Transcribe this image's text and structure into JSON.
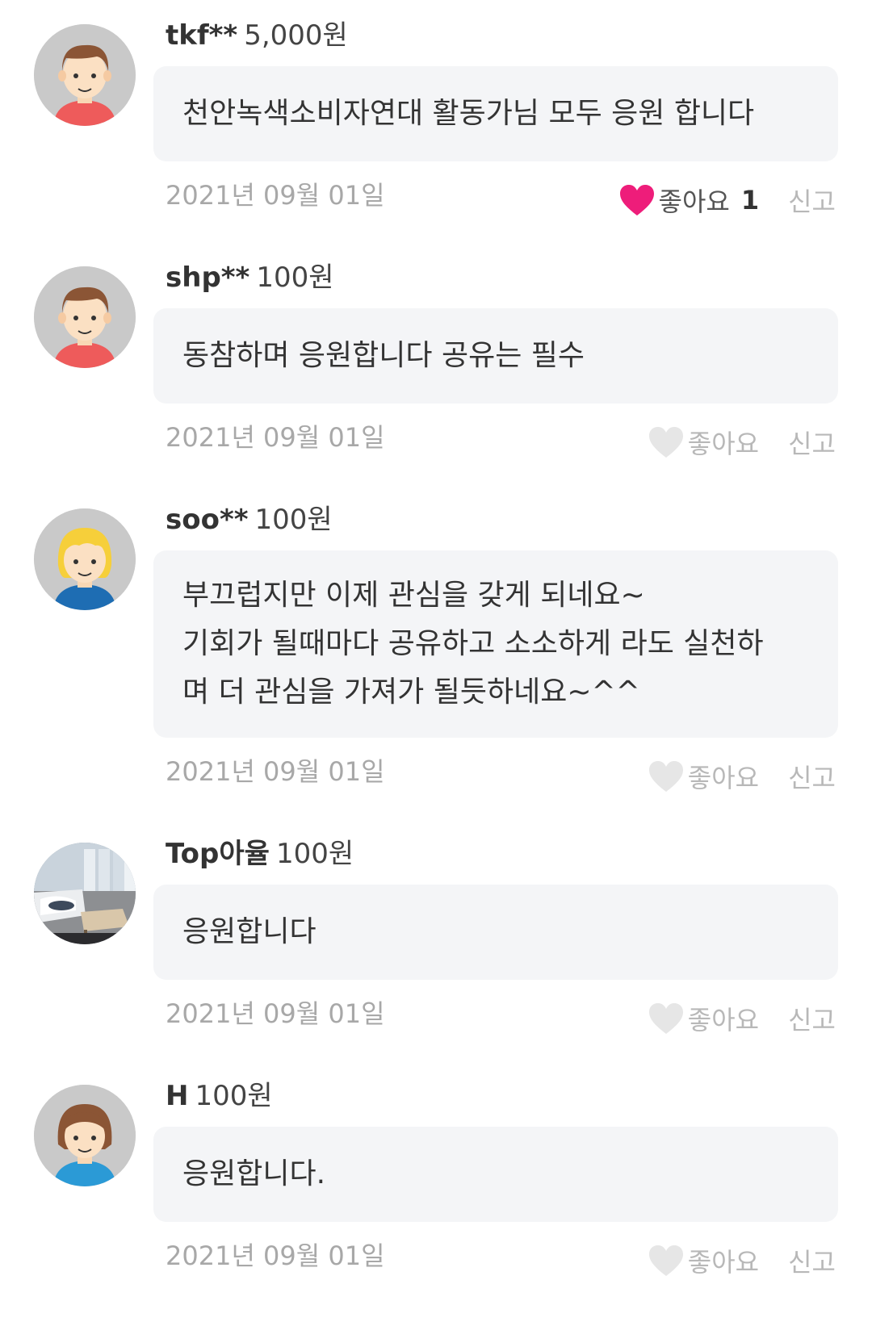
{
  "colors": {
    "like_active": "#ee1d7a",
    "like_inactive": "#e6e6e6",
    "bubble_bg": "#f4f5f7"
  },
  "comments": [
    {
      "username": "tkf**",
      "amount": "5,000원",
      "text": "천안녹색소비자연대 활동가님 모두 응원 합니다",
      "date": "2021년 09월 01일",
      "like_label": "좋아요",
      "like_count": "1",
      "liked": true,
      "report_label": "신고",
      "avatar_icon": "boy-avatar-icon"
    },
    {
      "username": "shp**",
      "amount": "100원",
      "text": "동참하며 응원합니다 공유는 필수",
      "date": "2021년 09월 01일",
      "like_label": "좋아요",
      "like_count": "",
      "liked": false,
      "report_label": "신고",
      "avatar_icon": "boy-avatar-icon"
    },
    {
      "username": "soo**",
      "amount": "100원",
      "text": "부끄럽지만 이제 관심을 갖게 되네요~\n기회가 될때마다 공유하고 소소하게 라도 실천하\n며 더 관심을 가져가 될듯하네요~^^",
      "date": "2021년 09월 01일",
      "like_label": "좋아요",
      "like_count": "",
      "liked": false,
      "report_label": "신고",
      "avatar_icon": "blonde-child-avatar-icon"
    },
    {
      "username": "Top아율",
      "amount": "100원",
      "text": "응원합니다",
      "date": "2021년 09월 01일",
      "like_label": "좋아요",
      "like_count": "",
      "liked": false,
      "report_label": "신고",
      "avatar_icon": "room-photo-avatar"
    },
    {
      "username": "H",
      "amount": "100원",
      "text": "응원합니다.",
      "date": "2021년 09월 01일",
      "like_label": "좋아요",
      "like_count": "",
      "liked": false,
      "report_label": "신고",
      "avatar_icon": "girl-avatar-icon"
    }
  ]
}
